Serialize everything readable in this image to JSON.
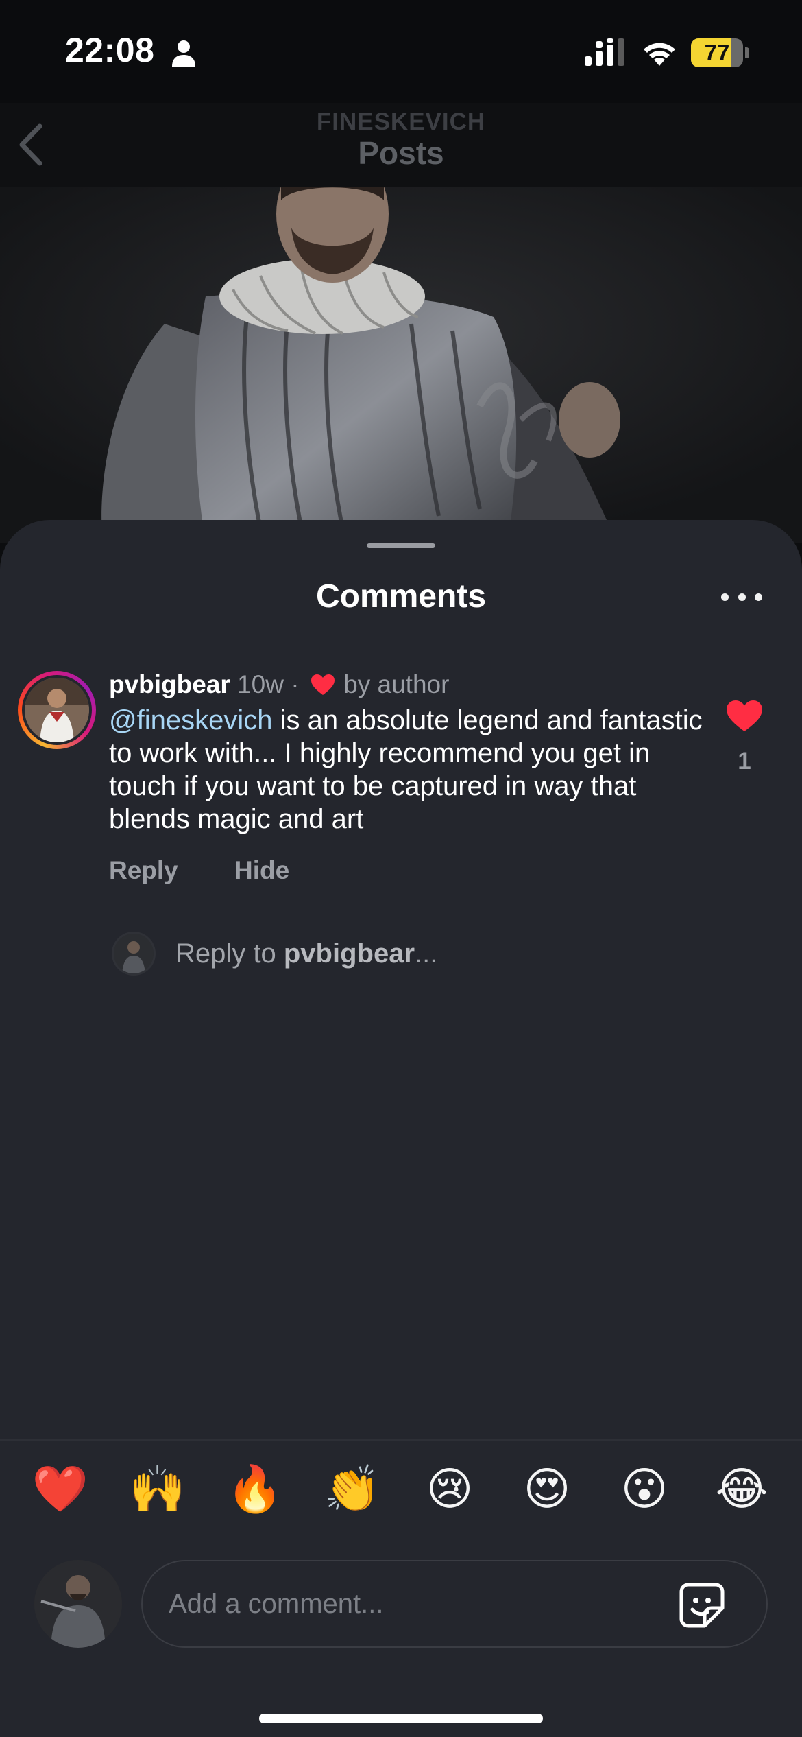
{
  "status_bar": {
    "time": "22:08",
    "battery_percent": 77,
    "battery_label": "77",
    "icons": [
      "person-icon",
      "cellular-signal-icon",
      "wifi-icon",
      "battery-icon"
    ]
  },
  "header": {
    "eyebrow": "FINESKEVICH",
    "title": "Posts",
    "back_icon": "chevron-left-icon"
  },
  "sheet": {
    "title": "Comments",
    "more_icon": "ellipsis-icon"
  },
  "comment": {
    "username": "pvbigbear",
    "time": "10w",
    "separator": "·",
    "liked_by": "by author",
    "mention": "@fineskevich",
    "text": " is an absolute legend and fantastic to work with... I highly recommend you get in touch if you want to be captured in way that blends magic and art",
    "actions": {
      "reply": "Reply",
      "hide": "Hide"
    },
    "like_count": "1",
    "like_color": "#ff2d43"
  },
  "reply_prompt": {
    "prefix": "Reply to ",
    "username": "pvbigbear",
    "suffix": "..."
  },
  "reactions": [
    "❤️",
    "🙌",
    "🔥",
    "👏",
    "😢",
    "😍",
    "😮",
    "😂"
  ],
  "composer": {
    "placeholder": "Add a comment...",
    "sticker_icon": "sticker-icon"
  },
  "colors": {
    "sheet_background": "#24262d",
    "mention": "#a8d6f5",
    "battery": "#f4d532",
    "like_red": "#ff2d43"
  }
}
